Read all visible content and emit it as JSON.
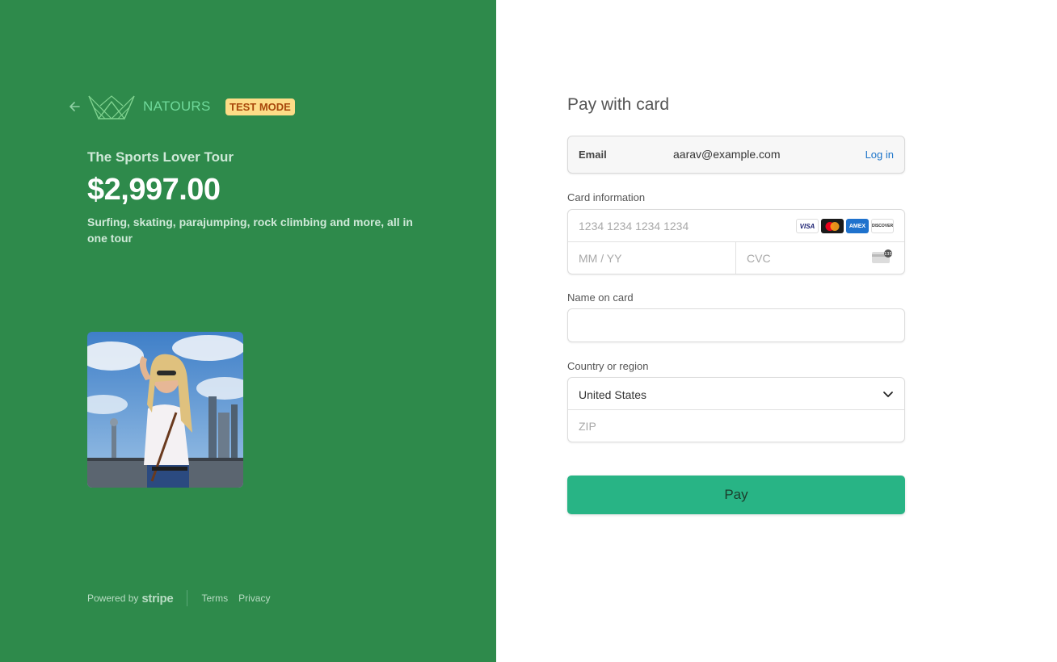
{
  "brand": {
    "name": "NATOURS",
    "test_mode_badge": "TEST MODE",
    "logo_icon": "crown-logo-icon",
    "color": "#2e8a4b"
  },
  "product": {
    "name": "The Sports Lover Tour",
    "price": "$2,997.00",
    "description": "Surfing, skating, parajumping, rock climbing and more, all in one tour"
  },
  "footer": {
    "powered_by": "Powered by",
    "stripe": "stripe",
    "terms": "Terms",
    "privacy": "Privacy"
  },
  "form": {
    "title": "Pay with card",
    "email": {
      "label": "Email",
      "value": "aarav@example.com",
      "login": "Log in"
    },
    "card": {
      "label": "Card information",
      "number_placeholder": "1234 1234 1234 1234",
      "expiry_placeholder": "MM / YY",
      "cvc_placeholder": "CVC",
      "brands": [
        "VISA",
        "mastercard",
        "AMEX",
        "DISCOVER"
      ]
    },
    "name": {
      "label": "Name on card",
      "value": ""
    },
    "country": {
      "label": "Country or region",
      "selected": "United States",
      "zip_placeholder": "ZIP"
    },
    "pay_button": "Pay",
    "accent_color": "#28b485"
  }
}
